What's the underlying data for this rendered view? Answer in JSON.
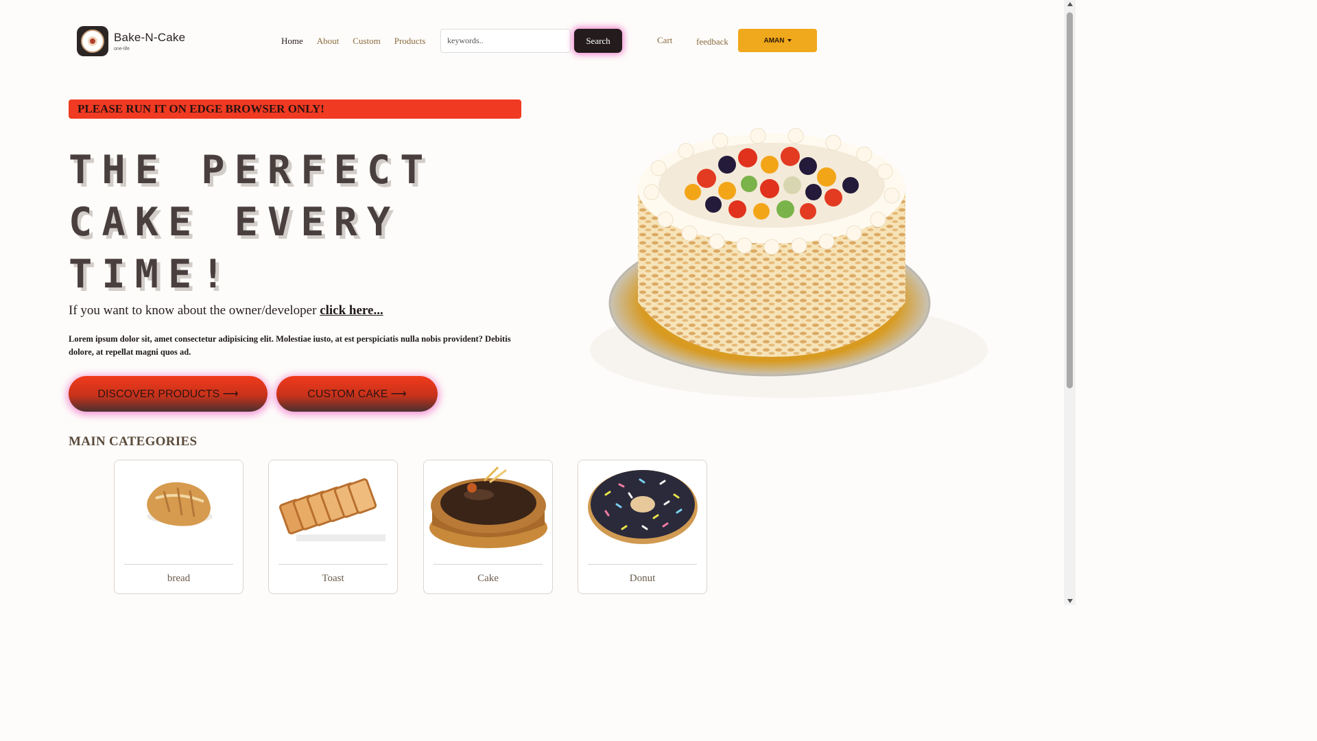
{
  "brand": {
    "name": "Bake-N-Cake",
    "tagline": "one-life"
  },
  "nav": {
    "items": [
      {
        "label": "Home",
        "active": true
      },
      {
        "label": "About"
      },
      {
        "label": "Custom"
      },
      {
        "label": "Products"
      }
    ],
    "search": {
      "placeholder": "keywords..",
      "button": "Search"
    },
    "cart": "Cart",
    "feedback": "feedback",
    "user": "AMAN"
  },
  "hero": {
    "warning": "PLEASE RUN IT ON EDGE BROWSER ONLY!",
    "title_lines": [
      "THE PERFECT",
      "CAKE EVERY",
      "TIME!"
    ],
    "owner_text": "If you want to know about the owner/developer ",
    "owner_link": "click here...",
    "lorem": "Lorem ipsum dolor sit, amet consectetur adipisicing elit. Molestiae iusto, at est perspiciatis nulla nobis provident? Debitis dolore, at repellat magni quos ad.",
    "cta_primary": "DISCOVER PRODUCTS ⟶",
    "cta_secondary": "CUSTOM CAKE ⟶"
  },
  "categories": {
    "heading": "MAIN CATEGORIES",
    "items": [
      {
        "label": "bread",
        "icon": "bread-image"
      },
      {
        "label": "Toast",
        "icon": "toast-image"
      },
      {
        "label": "Cake",
        "icon": "cake-image"
      },
      {
        "label": "Donut",
        "icon": "donut-image"
      }
    ]
  },
  "colors": {
    "accent_red": "#f13a22",
    "accent_yellow": "#f0a81c",
    "dark": "#241c1c",
    "glow_pink": "#f07bc8"
  }
}
